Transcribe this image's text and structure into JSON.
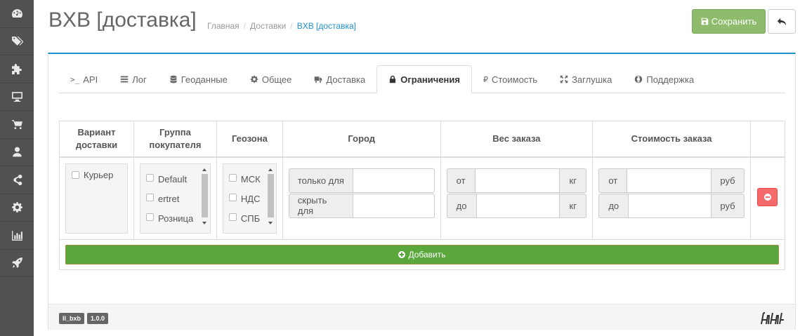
{
  "sidebar": {
    "icons": [
      "dashboard-icon",
      "tags-icon",
      "puzzle-icon",
      "monitor-icon",
      "cart-icon",
      "user-icon",
      "share-icon",
      "cog-icon",
      "bar-chart-icon",
      "rocket-icon"
    ]
  },
  "header": {
    "title": "BXB [доставка]",
    "breadcrumb": [
      "Главная",
      "Доставки",
      "BXB [доставка]"
    ],
    "save_label": "Сохранить"
  },
  "tabs": [
    {
      "label": "API",
      "icon": "terminal-icon"
    },
    {
      "label": "Лог",
      "icon": "list-icon"
    },
    {
      "label": "Геоданные",
      "icon": "database-icon"
    },
    {
      "label": "Общее",
      "icon": "cog-icon"
    },
    {
      "label": "Доставка",
      "icon": "truck-icon"
    },
    {
      "label": "Ограничения",
      "icon": "lock-icon",
      "active": true
    },
    {
      "label": "Стоимость",
      "icon": "ruble-icon"
    },
    {
      "label": "Заглушка",
      "icon": "arrows-icon"
    },
    {
      "label": "Поддержка",
      "icon": "lifebuoy-icon"
    }
  ],
  "table": {
    "headers": {
      "variant": "Вариант доставки",
      "group": "Группа покупателя",
      "geozone": "Геозона",
      "city": "Город",
      "weight": "Вес заказа",
      "cost": "Стоимость заказа"
    },
    "variants": [
      "Курьер"
    ],
    "groups": [
      "Default",
      "ertret",
      "Розница"
    ],
    "geozones": [
      "МСК",
      "НДС",
      "СПБ"
    ],
    "city": {
      "only_for": "только для",
      "hide_for": "скрыть для"
    },
    "weight": {
      "from": "от",
      "to": "до",
      "unit": "кг"
    },
    "cost": {
      "from": "от",
      "to": "до",
      "unit": "руб"
    },
    "add_label": "Добавить"
  },
  "footer": {
    "module_badge": "ll_bxb",
    "version_badge": "1.0.0",
    "logo": "logo"
  }
}
